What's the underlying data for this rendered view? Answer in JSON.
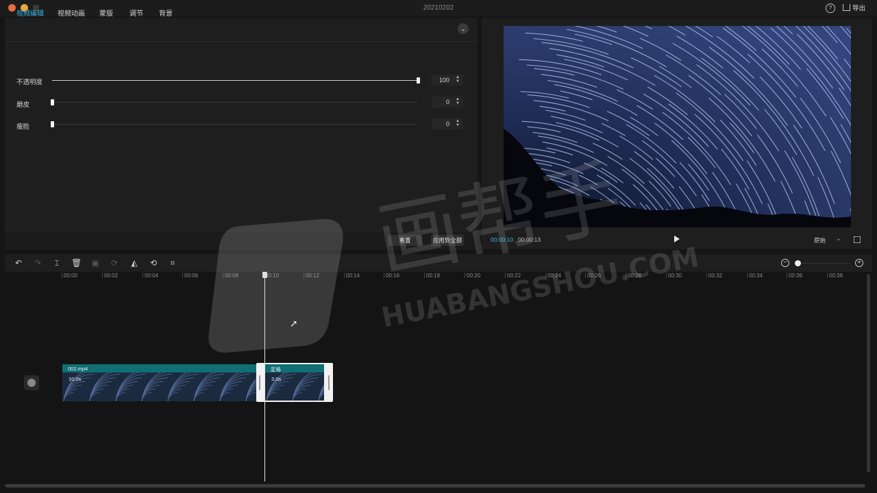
{
  "window": {
    "title": "20210202"
  },
  "header_right": {
    "help_icon": "question-circle-icon",
    "export_label": "导出",
    "export_icon": "share-export-icon"
  },
  "tabs": [
    {
      "label": "视频编辑",
      "active": true
    },
    {
      "label": "视频动画",
      "active": false
    },
    {
      "label": "蒙版",
      "active": false
    },
    {
      "label": "调节",
      "active": false
    },
    {
      "label": "背景",
      "active": false
    }
  ],
  "adjust": {
    "rows": [
      {
        "label": "不透明度",
        "value": "100",
        "level": 1.0
      },
      {
        "label": "磨皮",
        "value": "0",
        "level": 0.0
      },
      {
        "label": "瘦脸",
        "value": "0",
        "level": 0.0
      }
    ],
    "reset_label": "重置",
    "apply_all_label": "应用到全部"
  },
  "preview": {
    "current_time": "00:00:10",
    "total_time": "00:00:13",
    "ratio_label": "原始",
    "accent": "#37b5e6"
  },
  "timeline": {
    "ticks": [
      "00:00",
      "00:02",
      "00:04",
      "00:06",
      "00:08",
      "00:10",
      "00:12",
      "00:14",
      "00:16",
      "00:18",
      "00:20",
      "00:22",
      "00:24",
      "00:26",
      "00:28",
      "00:30",
      "00:32",
      "00:34",
      "00:36",
      "00:38"
    ],
    "clips": [
      {
        "name": "002.mp4",
        "duration": "10.0s"
      },
      {
        "name": "定格",
        "duration": "3.0s"
      }
    ]
  },
  "watermark": {
    "brand": "画帮手",
    "domain": "HUABANGSHOU.COM"
  }
}
